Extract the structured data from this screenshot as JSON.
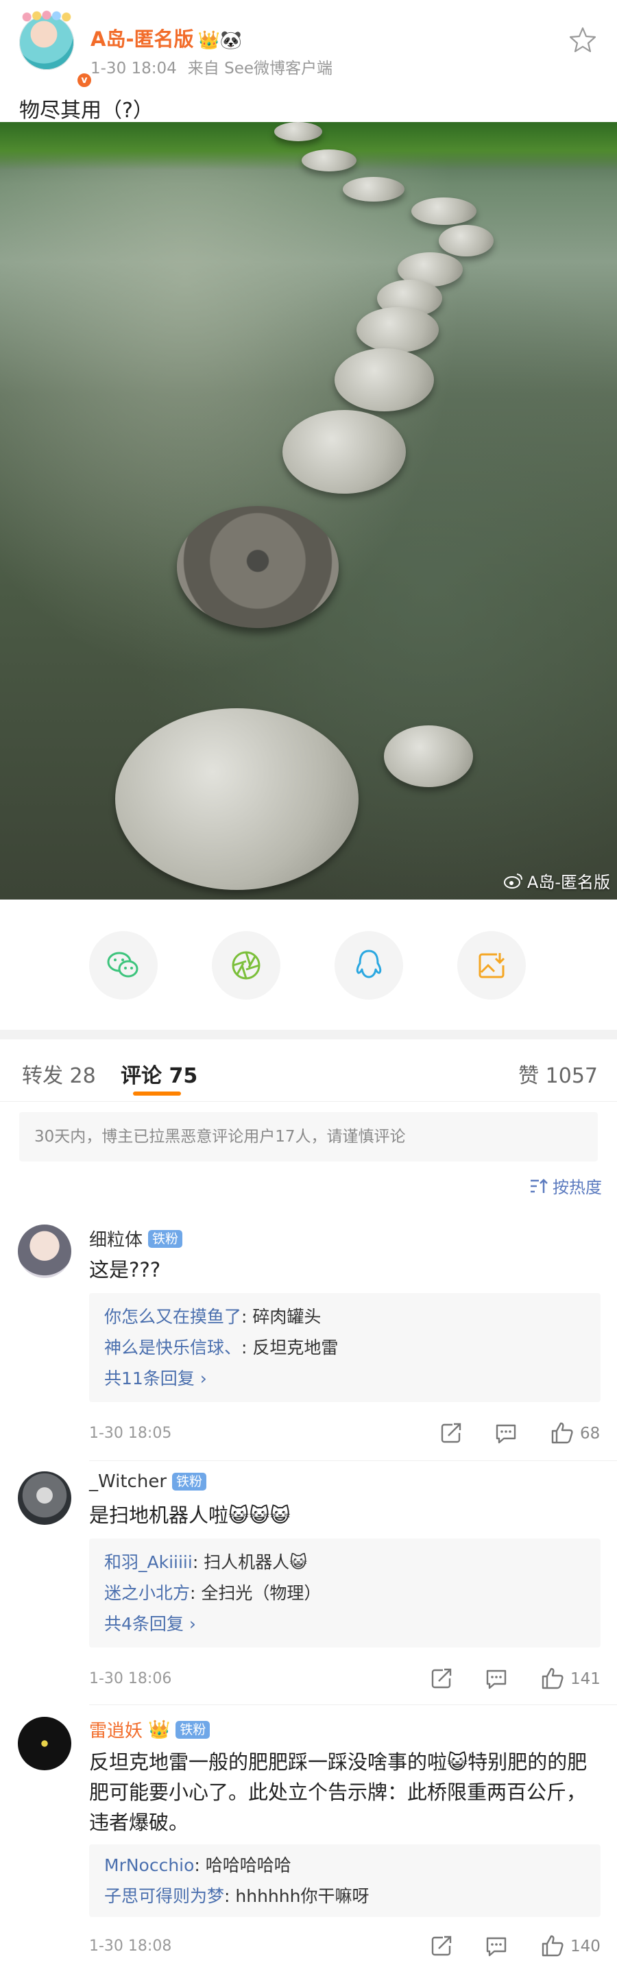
{
  "post": {
    "username": "A岛-匿名版",
    "badges_emoji": "👑🐼",
    "verify_mark": "v",
    "time": "1-30 18:04",
    "source": "来自 See微博客户端",
    "text": "物尽其用（?）",
    "watermark": "A岛-匿名版"
  },
  "share": {
    "buttons": [
      "wechat",
      "moments",
      "qq",
      "save-image"
    ]
  },
  "tabs": {
    "repost": "转发 28",
    "comments": "评论 75",
    "likes": "赞 1057"
  },
  "notice": "30天内，博主已拉黑恶意评论用户17人，请谨慎评论",
  "sort_label": "按热度",
  "comments": [
    {
      "name": "细粒体",
      "fan_badge": "铁粉",
      "text": "这是???",
      "replies": [
        {
          "user": "你怎么又在摸鱼了",
          "text": ": 碎肉罐头"
        },
        {
          "user": "神么是快乐信球、",
          "text": ": 反坦克地雷"
        }
      ],
      "more": "共11条回复 ›",
      "time": "1-30 18:05",
      "likes": "68"
    },
    {
      "name": "_Witcher",
      "fan_badge": "铁粉",
      "text": "是扫地机器人啦😺😺😺",
      "replies": [
        {
          "user": "和羽_Akiiiii",
          "text": ": 扫人机器人😺"
        },
        {
          "user": "迷之小北方",
          "text": ": 全扫光（物理）"
        }
      ],
      "more": "共4条回复 ›",
      "time": "1-30 18:06",
      "likes": "141"
    },
    {
      "name": "雷逍妖",
      "name_emoji": "👑",
      "fan_badge": "铁粉",
      "text": "反坦克地雷一般的肥肥踩一踩没啥事的啦😺特别肥的的肥肥可能要小心了。此处立个告示牌：此桥限重两百公斤，违者爆破。",
      "replies": [
        {
          "user": "MrNocchio",
          "text": ": 哈哈哈哈哈"
        },
        {
          "user": "子思可得则为梦",
          "text": ": hhhhhh你干嘛呀"
        }
      ],
      "time": "1-30 18:08",
      "likes": "140"
    }
  ],
  "colors": {
    "accent_orange": "#f26c2a",
    "link_blue": "#4a6fae",
    "tab_underline": "#ff8200",
    "fan_badge": "#6fa7e8"
  }
}
